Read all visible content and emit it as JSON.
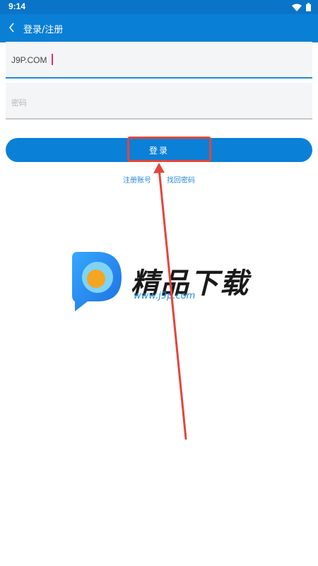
{
  "status_bar": {
    "time": "9:14"
  },
  "app_bar": {
    "title": "登录/注册"
  },
  "form": {
    "username_value": "J9P.COM",
    "password_placeholder": "密码",
    "login_label": "登录",
    "register_link": "注册账号",
    "forgot_link": "找回密码"
  },
  "watermark": {
    "brand": "精品下载",
    "url": "www.j9p.com"
  },
  "colors": {
    "primary": "#0a7fd6",
    "highlight": "#e3453d",
    "link": "#2b88d8"
  }
}
